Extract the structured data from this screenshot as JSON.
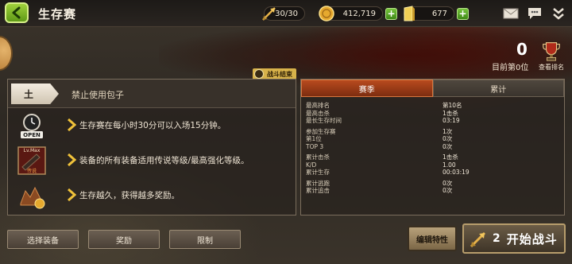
{
  "header": {
    "title": "生存赛",
    "stamina": "30/30",
    "gold": "412,719",
    "gems": "677"
  },
  "rank": {
    "number": "0",
    "label": "目前第0位",
    "view_button": "查看排名"
  },
  "battle_end_label": "战斗结束",
  "tier": {
    "badge": "土",
    "description": "禁止使用包子"
  },
  "rules": [
    {
      "icon": "open-clock-icon",
      "icon_text": "OPEN",
      "text": "生存赛在每小时30分可以入场15分钟。"
    },
    {
      "icon": "lvmax-item-icon",
      "icon_text": "Lv.Max",
      "icon_subtext": "传说",
      "text": "装备的所有装备适用传说等级/最高强化等级。"
    },
    {
      "icon": "reward-pile-icon",
      "text": "生存越久，获得越多奖励。"
    }
  ],
  "tabs": [
    {
      "label": "赛季",
      "active": true
    },
    {
      "label": "累计",
      "active": false
    }
  ],
  "stats": [
    {
      "key": "最高排名",
      "value": "第10名"
    },
    {
      "key": "最高击杀",
      "value": "1击杀"
    },
    {
      "key": "最长生存时间",
      "value": "03:19"
    },
    {
      "key": "参加生存赛",
      "value": "1次"
    },
    {
      "key": "第1位",
      "value": "0次"
    },
    {
      "key": "TOP 3",
      "value": "0次"
    },
    {
      "key": "累计击杀",
      "value": "1击杀"
    },
    {
      "key": "K/D",
      "value": "1.00"
    },
    {
      "key": "累计生存",
      "value": "00:03:19"
    },
    {
      "key": "累计逃跑",
      "value": "0次"
    },
    {
      "key": "累计追击",
      "value": "0次"
    }
  ],
  "buttons": {
    "select_gear": "选择装备",
    "rewards": "奖励",
    "restrictions": "限制",
    "edit_traits": "编辑特性",
    "start_cost": "2",
    "start_battle": "开始战斗"
  },
  "colors": {
    "accent_green": "#76c33b",
    "tab_active": "#b84a1e",
    "battle_end_tag": "#d8b24a"
  }
}
